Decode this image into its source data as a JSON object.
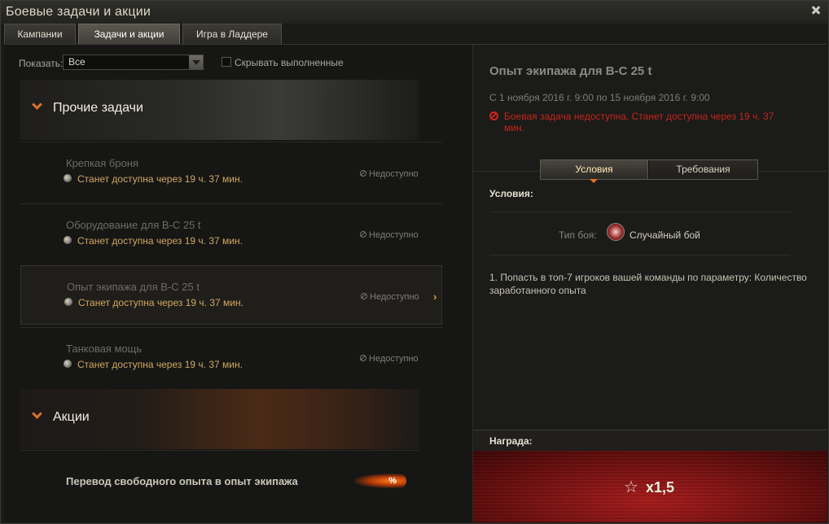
{
  "window": {
    "title": "Боевые задачи и акции"
  },
  "tabs": [
    {
      "label": "Кампании"
    },
    {
      "label": "Задачи и акции"
    },
    {
      "label": "Игра в Ладдере"
    }
  ],
  "filter": {
    "show_label": "Показать:",
    "show_value": "Все",
    "hide_completed_label": "Скрывать выполненные"
  },
  "groups": {
    "other": {
      "title": "Прочие задачи"
    },
    "actions": {
      "title": "Акции"
    }
  },
  "quests": [
    {
      "name": "Крепкая броня",
      "availability": "Станет доступна через 19 ч. 37 мин.",
      "status": "Недоступно"
    },
    {
      "name": "Оборудование для В-С 25 t",
      "availability": "Станет доступна через 19 ч. 37 мин.",
      "status": "Недоступно"
    },
    {
      "name": "Опыт экипажа для В-С 25 t",
      "availability": "Станет доступна через 19 ч. 37 мин.",
      "status": "Недоступно"
    },
    {
      "name": "Танковая мощь",
      "availability": "Станет доступна через 19 ч. 37 мин.",
      "status": "Недоступно"
    }
  ],
  "promo": {
    "title": "Перевод свободного опыта в опыт экипажа",
    "badge": "%"
  },
  "details": {
    "title": "Опыт экипажа для В-С 25 t",
    "date": "С 1 ноября 2016 г. 9:00 по 15 ноября 2016 г. 9:00",
    "warning": "Боевая задача недоступна. Станет доступна через 19 ч. 37 мин.",
    "subtabs": {
      "conditions": "Условия",
      "requirements": "Требования"
    },
    "conditions_label": "Условия:",
    "battle_type_label": "Тип боя:",
    "battle_type_value": "Случайный бой",
    "condition_text": "1. Попасть в топ-7 игроков вашей команды по параметру: Количество заработанного опыта",
    "reward_label": "Награда:",
    "reward_value": "x1,5"
  }
}
